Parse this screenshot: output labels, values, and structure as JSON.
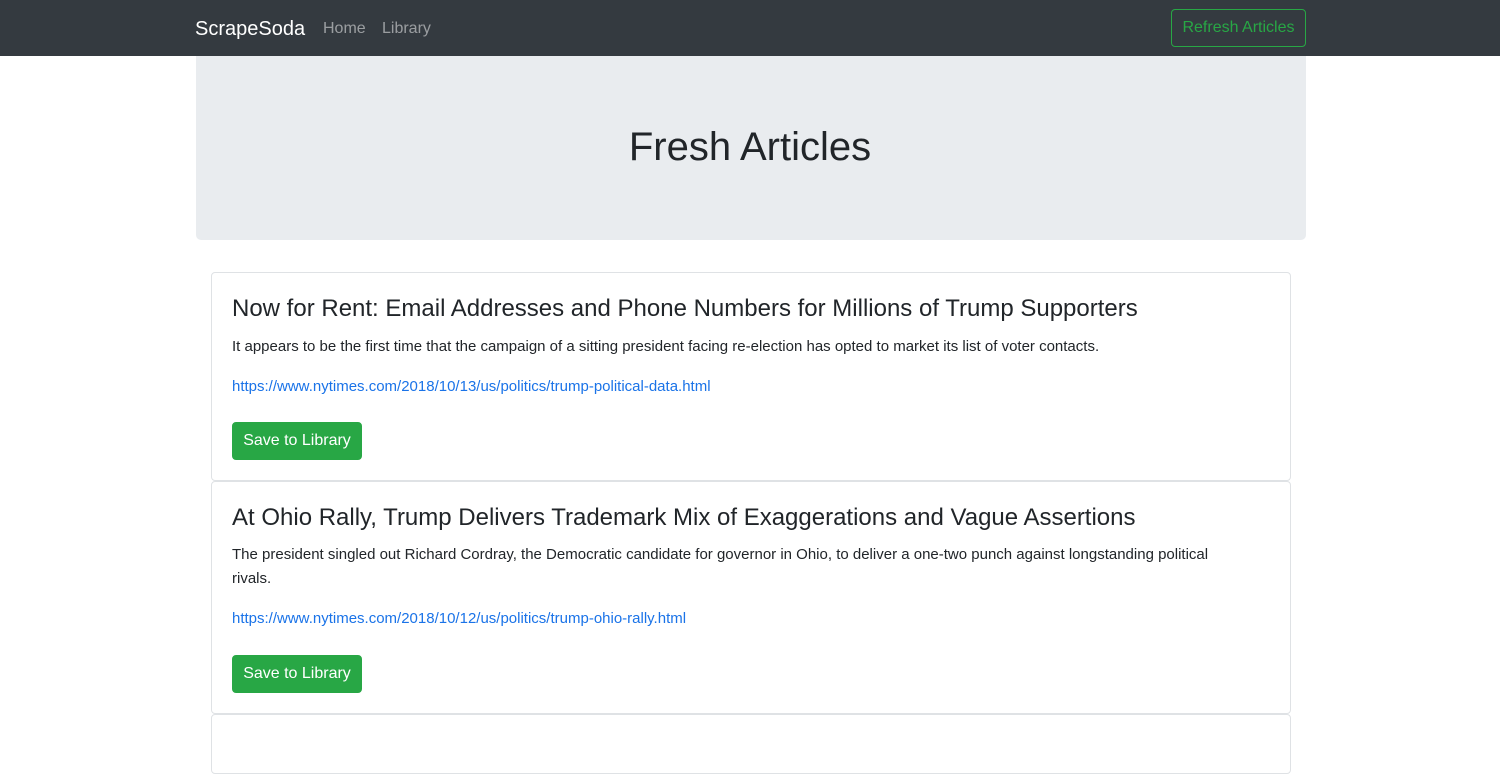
{
  "navbar": {
    "brand": "ScrapeSoda",
    "links": [
      {
        "label": "Home"
      },
      {
        "label": "Library"
      }
    ],
    "refresh_label": "Refresh Articles"
  },
  "jumbotron": {
    "title": "Fresh Articles"
  },
  "articles": [
    {
      "title": "Now for Rent: Email Addresses and Phone Numbers for Millions of Trump Supporters",
      "summary": "It appears to be the first time that the campaign of a sitting president facing re-election has opted to market its list of voter contacts.",
      "url": "https://www.nytimes.com/2018/10/13/us/politics/trump-political-data.html",
      "save_label": "Save to Library"
    },
    {
      "title": "At Ohio Rally, Trump Delivers Trademark Mix of Exaggerations and Vague Assertions",
      "summary": "The president singled out Richard Cordray, the Democratic candidate for governor in Ohio, to deliver a one-two punch against longstanding political rivals.",
      "url": "https://www.nytimes.com/2018/10/12/us/politics/trump-ohio-rally.html",
      "save_label": "Save to Library"
    }
  ],
  "colors": {
    "navbar_bg": "#343a40",
    "jumbotron_bg": "#e9ecef",
    "success": "#28a745",
    "link": "#1a73e8"
  }
}
